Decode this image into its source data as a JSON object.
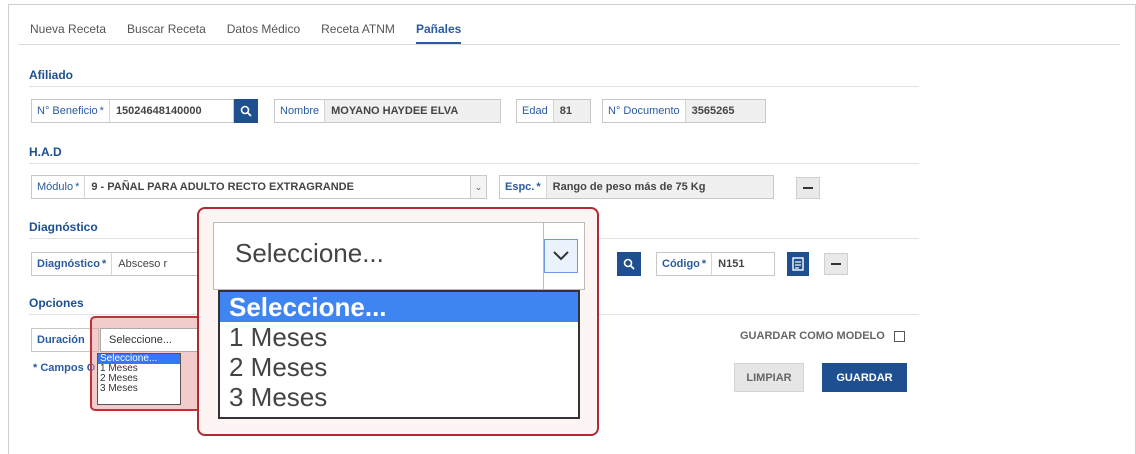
{
  "tabs": [
    "Nueva Receta",
    "Buscar Receta",
    "Datos Médico",
    "Receta ATNM",
    "Pañales"
  ],
  "afiliado": {
    "title": "Afiliado",
    "beneficio_label": "N° Beneficio",
    "beneficio_value": "15024648140000",
    "nombre_label": "Nombre",
    "nombre_value": "MOYANO HAYDEE ELVA",
    "edad_label": "Edad",
    "edad_value": "81",
    "documento_label": "N° Documento",
    "documento_value": "3565265"
  },
  "had": {
    "title": "H.A.D",
    "modulo_label": "Módulo",
    "modulo_value": "9 - PAÑAL PARA ADULTO RECTO EXTRAGRANDE",
    "espc_label": "Espc.",
    "espc_value": "Rango de peso más de 75 Kg"
  },
  "diagnostico": {
    "title": "Diagnóstico",
    "diag_label": "Diagnóstico",
    "diag_value": "Absceso r",
    "codigo_label": "Código",
    "codigo_value": "N151"
  },
  "opciones": {
    "title": "Opciones",
    "duracion_label": "Duración",
    "guardar_modelo": "GUARDAR COMO MODELO",
    "campos_note": "* Campos O",
    "limpiar": "LIMPIAR",
    "guardar": "GUARDAR"
  },
  "required_mark": "*",
  "duracion_dropdown": {
    "selected": "Seleccione...",
    "options": [
      "Seleccione...",
      "1 Meses",
      "2 Meses",
      "3 Meses"
    ]
  },
  "zoom_peek_char": "C",
  "colors": {
    "accent": "#1d4f91",
    "highlight_border": "#c0313a",
    "selection": "#3478f6"
  }
}
